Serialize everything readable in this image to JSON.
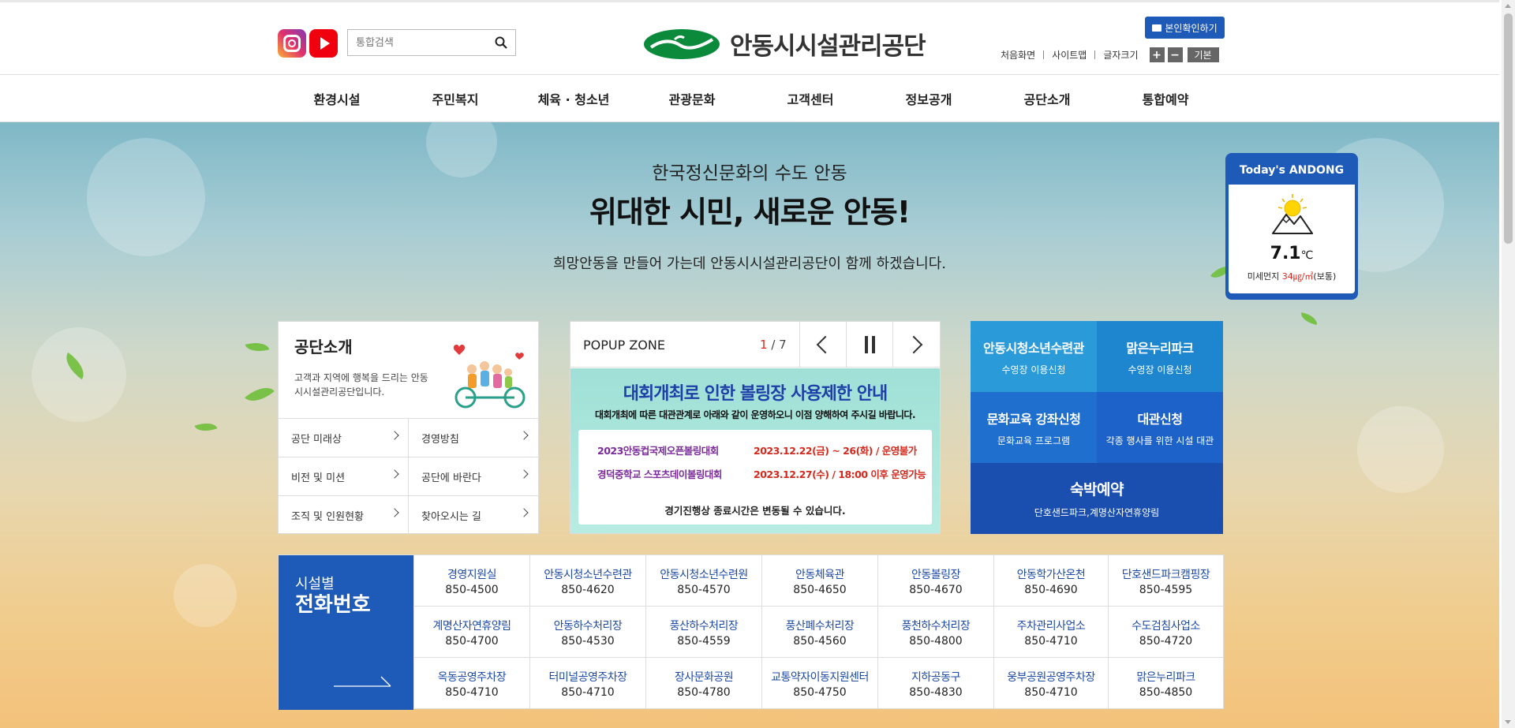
{
  "header": {
    "search_placeholder": "통합검색",
    "logo_text": "안동시시설관리공단",
    "verify_label": "본인확인하기",
    "util_links": [
      "처음화면",
      "사이트맵",
      "글자크기"
    ],
    "font_plus": "+",
    "font_minus": "−",
    "font_basic": "기본"
  },
  "nav": [
    "환경시설",
    "주민복지",
    "체육 · 청소년",
    "관광문화",
    "고객센터",
    "정보공개",
    "공단소개",
    "통합예약"
  ],
  "hero": {
    "subtitle": "한국정신문화의 수도 안동",
    "title": "위대한 시민, 새로운 안동!",
    "desc": "희망안동을 만들어 가는데 안동시시설관리공단이 함께 하겠습니다."
  },
  "weather": {
    "title": "Today's ANDONG",
    "temp": "7.1",
    "unit": "℃",
    "dust_label": "미세먼지",
    "dust_value": "34㎍/㎥",
    "dust_status": "(보통)"
  },
  "about": {
    "title": "공단소개",
    "desc": "고객과 지역에 행복을 드리는 안동시시설관리공단입니다.",
    "links": [
      "공단 미래상",
      "경영방침",
      "비전 및 미션",
      "공단에 바란다",
      "조직 및 인원현황",
      "찾아오시는 길"
    ]
  },
  "popup": {
    "title": "POPUP ZONE",
    "current": "1",
    "total": "/ 7",
    "banner_title": "대회개최로 인한 볼링장 사용제한 안내",
    "banner_sub": "대회개최에 따른 대관관계로 아래와 같이 운영하오니 이점 양해하여 주시길 바랍니다.",
    "events": [
      {
        "name": "2023안동컵국제오픈볼링대회",
        "date": "2023.12.22(금) ~ 26(화) / 운영불가"
      },
      {
        "name": "경덕중학교 스포츠데이볼링대회",
        "date": "2023.12.27(수) / 18:00 이후 운영가능"
      }
    ],
    "note": "경기진행상 종료시간은 변동될 수 있습니다."
  },
  "quick": [
    {
      "title": "안동시청소년수련관",
      "sub": "수영장 이용신청",
      "color": "#2a9ad8"
    },
    {
      "title": "맑은누리파크",
      "sub": "수영장 이용신청",
      "color": "#1e86cf"
    },
    {
      "title": "문화교육 강좌신청",
      "sub": "문화교육 프로그램",
      "color": "#1f6fcf"
    },
    {
      "title": "대관신청",
      "sub": "각종 행사를 위한 시설 대관",
      "color": "#1d62c8"
    },
    {
      "title": "숙박예약",
      "sub": "단호샌드파크,계명산자연휴양림",
      "color": "#1a4fb0"
    }
  ],
  "phone": {
    "label1": "시설별",
    "label2": "전화번호",
    "entries": [
      {
        "name": "경영지원실",
        "num": "850-4500"
      },
      {
        "name": "안동시청소년수련관",
        "num": "850-4620"
      },
      {
        "name": "안동시청소년수련원",
        "num": "850-4570"
      },
      {
        "name": "안동체육관",
        "num": "850-4650"
      },
      {
        "name": "안동볼링장",
        "num": "850-4670"
      },
      {
        "name": "안동학가산온천",
        "num": "850-4690"
      },
      {
        "name": "단호샌드파크캠핑장",
        "num": "850-4595"
      },
      {
        "name": "계명산자연휴양림",
        "num": "850-4700"
      },
      {
        "name": "안동하수처리장",
        "num": "850-4530"
      },
      {
        "name": "풍산하수처리장",
        "num": "850-4559"
      },
      {
        "name": "풍산폐수처리장",
        "num": "850-4560"
      },
      {
        "name": "풍천하수처리장",
        "num": "850-4800"
      },
      {
        "name": "주차관리사업소",
        "num": "850-4710"
      },
      {
        "name": "수도검침사업소",
        "num": "850-4720"
      },
      {
        "name": "옥동공영주차장",
        "num": "850-4710"
      },
      {
        "name": "터미널공영주차장",
        "num": "850-4710"
      },
      {
        "name": "장사문화공원",
        "num": "850-4780"
      },
      {
        "name": "교통약자이동지원센터",
        "num": "850-4750"
      },
      {
        "name": "지하공동구",
        "num": "850-4830"
      },
      {
        "name": "웅부공원공영주차장",
        "num": "850-4710"
      },
      {
        "name": "맑은누리파크",
        "num": "850-4850"
      }
    ]
  }
}
